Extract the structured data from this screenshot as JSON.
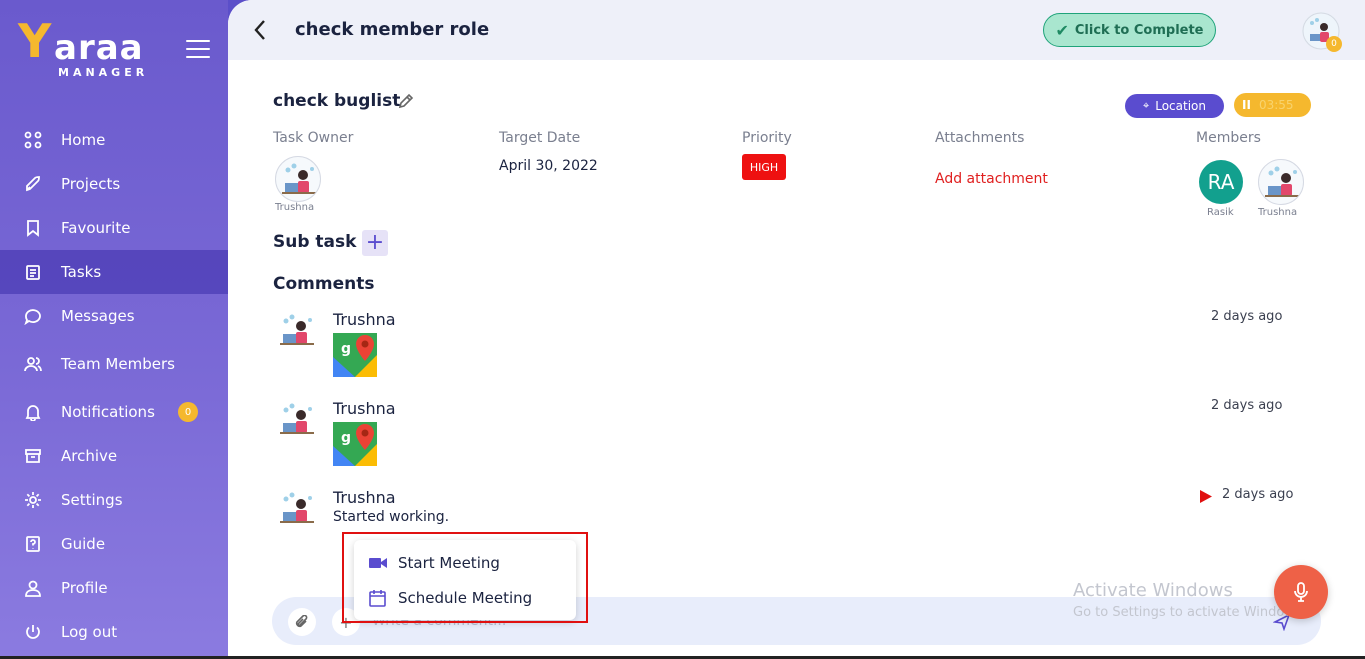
{
  "app": {
    "logo_y": "Y",
    "logo_rest": "araa",
    "logo_sub": "MANAGER"
  },
  "sidebar": {
    "items": [
      {
        "label": "Home",
        "icon": "grid-icon"
      },
      {
        "label": "Projects",
        "icon": "rocket-icon"
      },
      {
        "label": "Favourite",
        "icon": "bookmark-icon"
      },
      {
        "label": "Tasks",
        "icon": "clipboard-icon",
        "active": true
      },
      {
        "label": "Messages",
        "icon": "chat-icon"
      },
      {
        "label": "Team Members",
        "icon": "users-icon"
      },
      {
        "label": "Notifications",
        "icon": "bell-icon",
        "badge": "0"
      },
      {
        "label": "Archive",
        "icon": "archive-icon"
      },
      {
        "label": "Settings",
        "icon": "gear-icon"
      },
      {
        "label": "Guide",
        "icon": "help-icon"
      },
      {
        "label": "Profile",
        "icon": "user-icon"
      },
      {
        "label": "Log out",
        "icon": "power-icon"
      }
    ]
  },
  "header": {
    "title": "check member role",
    "complete_label": "Click to Complete",
    "avatar_badge": "0"
  },
  "task": {
    "title": "check buglist",
    "location_label": "Location",
    "timer_value": "03:55",
    "owner_label": "Task Owner",
    "owner_name": "Trushna",
    "target_date_label": "Target Date",
    "target_date": "April 30, 2022",
    "priority_label": "Priority",
    "priority": "HIGH",
    "attachments_label": "Attachments",
    "add_attachment": "Add attachment",
    "members_label": "Members",
    "members": [
      {
        "initials": "RA",
        "name": "Rasik"
      },
      {
        "name": "Trushna"
      }
    ]
  },
  "subtask": {
    "title": "Sub task"
  },
  "comments": {
    "title": "Comments",
    "items": [
      {
        "author": "Trushna",
        "time": "2 days ago",
        "type": "map"
      },
      {
        "author": "Trushna",
        "time": "2 days ago",
        "type": "map"
      },
      {
        "author": "Trushna",
        "time": "2 days ago",
        "text": "Started working.",
        "type": "text"
      }
    ]
  },
  "meeting_menu": {
    "start": "Start Meeting",
    "schedule": "Schedule Meeting"
  },
  "composer": {
    "placeholder": "Write a comment..."
  },
  "watermark": {
    "line1": "Activate Windows",
    "line2": "Go to Settings to activate Windows."
  },
  "colors": {
    "sidebar": "#6a5acd",
    "accent": "#5a4ccf",
    "complete": "#a9e6cf",
    "priority_high": "#ee1111",
    "timer": "#f5b82e"
  }
}
